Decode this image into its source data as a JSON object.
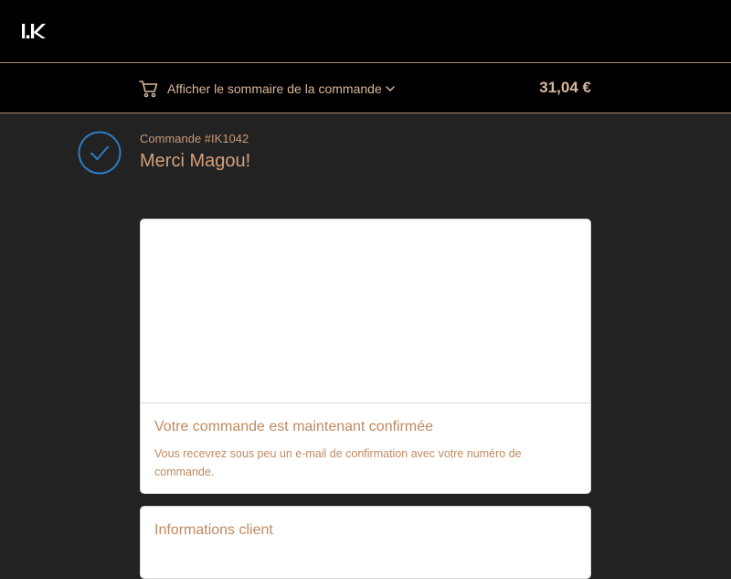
{
  "header": {
    "logo_text": "IK"
  },
  "summary": {
    "toggle_label": "Afficher le sommaire de la commande",
    "total": "31,04 €",
    "cart_icon": "cart-icon",
    "chevron_icon": "chevron-down-icon"
  },
  "order": {
    "number": "Commande #IK1042",
    "thanks": "Merci Magou!",
    "status_icon": "check-circle-icon"
  },
  "confirmation": {
    "title": "Votre commande est maintenant confirmée",
    "text": "Vous recevrez sous peu un e-mail de confirmation avec votre numéro de commande."
  },
  "customer_info": {
    "title": "Informations client"
  },
  "colors": {
    "background": "#222222",
    "header": "#000000",
    "accent": "#d4a07a",
    "check": "#2b7dc4"
  }
}
